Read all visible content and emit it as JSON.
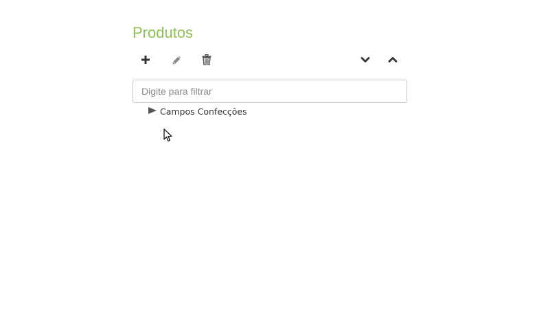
{
  "panel": {
    "title": "Produtos"
  },
  "toolbar": {
    "buttons": [
      {
        "name": "add",
        "icon": "plus-icon"
      },
      {
        "name": "edit",
        "icon": "pencil-icon"
      },
      {
        "name": "delete",
        "icon": "trash-icon"
      },
      {
        "name": "move-down",
        "icon": "chevron-down-icon"
      },
      {
        "name": "move-up",
        "icon": "chevron-up-icon"
      }
    ]
  },
  "filter": {
    "placeholder": "Digite para filtrar",
    "value": ""
  },
  "tree": {
    "nodes": [
      {
        "label": "Campos Confecções",
        "expanded": false
      }
    ]
  },
  "colors": {
    "title": "#8cc152",
    "icon_dark": "#333333",
    "icon_muted": "#8a8a8a",
    "input_border": "#c8c8c8"
  }
}
